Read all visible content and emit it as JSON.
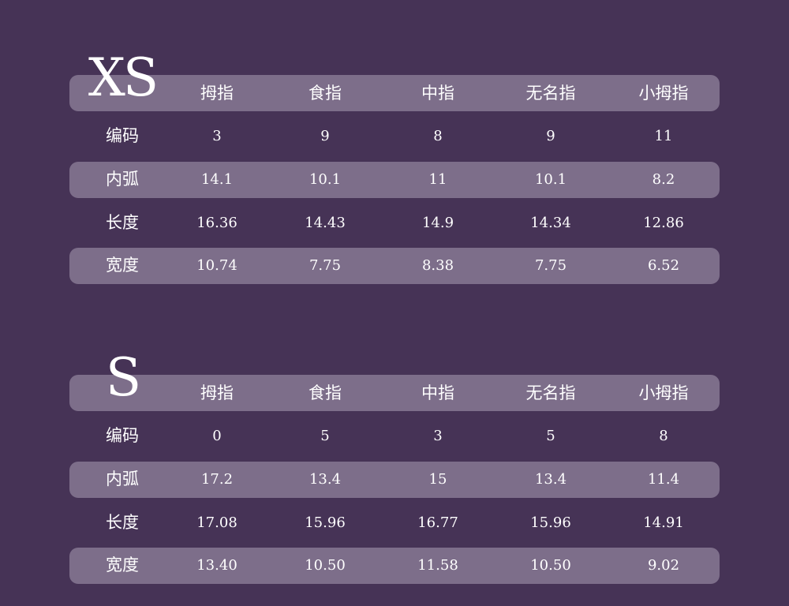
{
  "tables": [
    {
      "size": "XS",
      "columns": [
        "拇指",
        "食指",
        "中指",
        "无名指",
        "小拇指"
      ],
      "rows": [
        {
          "label": "编码",
          "values": [
            "3",
            "9",
            "8",
            "9",
            "11"
          ]
        },
        {
          "label": "内弧",
          "values": [
            "14.1",
            "10.1",
            "11",
            "10.1",
            "8.2"
          ]
        },
        {
          "label": "长度",
          "values": [
            "16.36",
            "14.43",
            "14.9",
            "14.34",
            "12.86"
          ]
        },
        {
          "label": "宽度",
          "values": [
            "10.74",
            "7.75",
            "8.38",
            "7.75",
            "6.52"
          ]
        }
      ]
    },
    {
      "size": "S",
      "columns": [
        "拇指",
        "食指",
        "中指",
        "无名指",
        "小拇指"
      ],
      "rows": [
        {
          "label": "编码",
          "values": [
            "0",
            "5",
            "3",
            "5",
            "8"
          ]
        },
        {
          "label": "内弧",
          "values": [
            "17.2",
            "13.4",
            "15",
            "13.4",
            "11.4"
          ]
        },
        {
          "label": "长度",
          "values": [
            "17.08",
            "15.96",
            "16.77",
            "15.96",
            "14.91"
          ]
        },
        {
          "label": "宽度",
          "values": [
            "13.40",
            "10.50",
            "11.58",
            "10.50",
            "9.02"
          ]
        }
      ]
    }
  ],
  "colors": {
    "background": "#463356",
    "band": "#7d6e8a",
    "text": "#ffffff"
  }
}
